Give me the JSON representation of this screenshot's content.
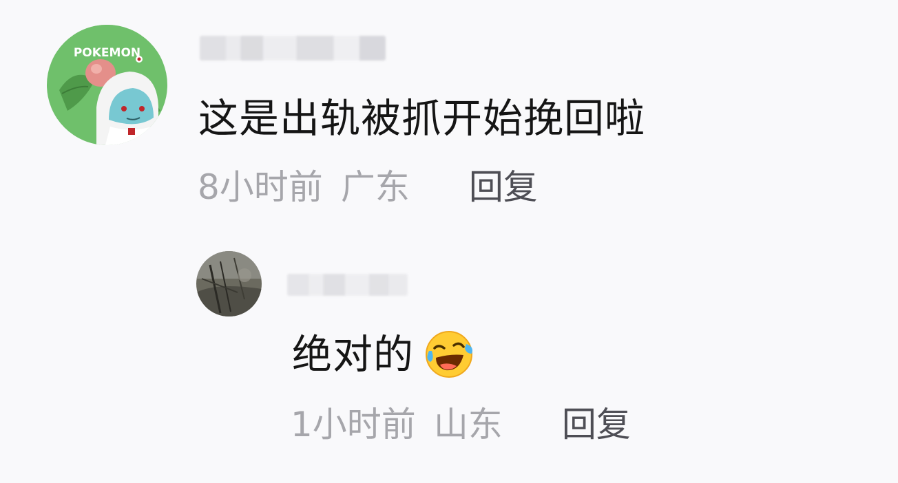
{
  "comment": {
    "avatar_logo_text": "POKEMON",
    "text": "这是出轨被抓开始挽回啦",
    "time": "8小时前",
    "location": "广东",
    "reply_label": "回复"
  },
  "reply": {
    "text": "绝对的",
    "emoji_icon": "crying-laughing-emoji",
    "time": "1小时前",
    "location": "山东",
    "reply_label": "回复"
  },
  "colors": {
    "background": "#f9f9fb",
    "text": "#151515",
    "meta_text": "#a6a6ab",
    "reply_label": "#4e4e55"
  }
}
